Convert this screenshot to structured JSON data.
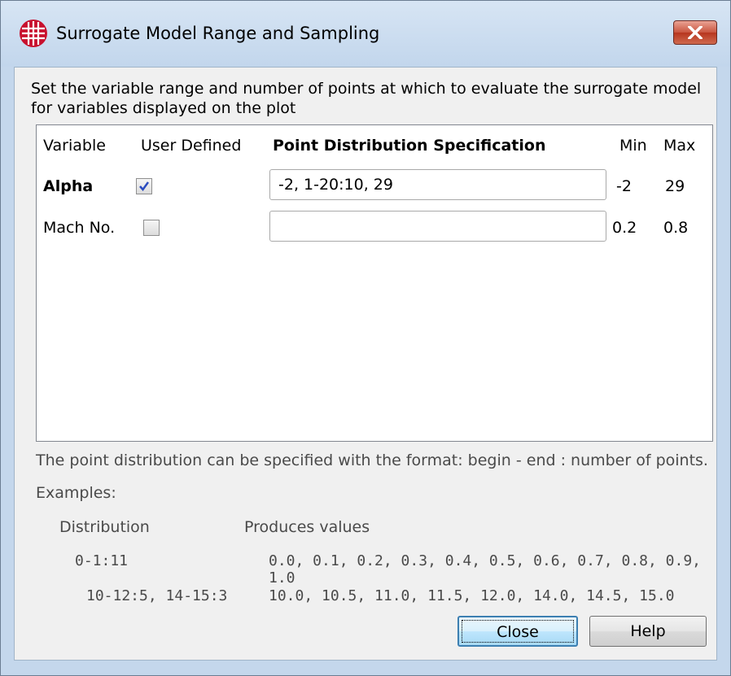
{
  "window": {
    "title": "Surrogate Model Range and Sampling",
    "colors": {
      "titlebar": "#c4d7ec",
      "close": "#c9553f",
      "default_button": "#3c7fb1"
    }
  },
  "intro": "Set the variable range and number of points at which to evaluate the surrogate model for variables displayed on the plot",
  "table": {
    "headers": {
      "variable": "Variable",
      "user_defined": "User Defined",
      "spec": "Point Distribution Specification",
      "min": "Min",
      "max": "Max"
    },
    "rows": [
      {
        "variable": "Alpha",
        "user_defined": true,
        "spec": "-2, 1-20:10, 29",
        "min": "-2",
        "max": "29"
      },
      {
        "variable": "Mach No.",
        "user_defined": false,
        "spec": "",
        "min": "0.2",
        "max": "0.8"
      }
    ]
  },
  "help": {
    "format_text": "The point distribution can be specified with the format: begin - end : number of points.",
    "examples_label": "Examples:",
    "col_distribution": "Distribution",
    "col_produces": "Produces values",
    "examples": [
      {
        "distribution": "0-1:11",
        "values": "0.0, 0.1, 0.2, 0.3, 0.4, 0.5, 0.6, 0.7, 0.8, 0.9, 1.0"
      },
      {
        "distribution": "10-12:5, 14-15:3",
        "values": "10.0, 10.5, 11.0, 11.5, 12.0, 14.0, 14.5, 15.0"
      }
    ]
  },
  "buttons": {
    "close": "Close",
    "help": "Help"
  }
}
